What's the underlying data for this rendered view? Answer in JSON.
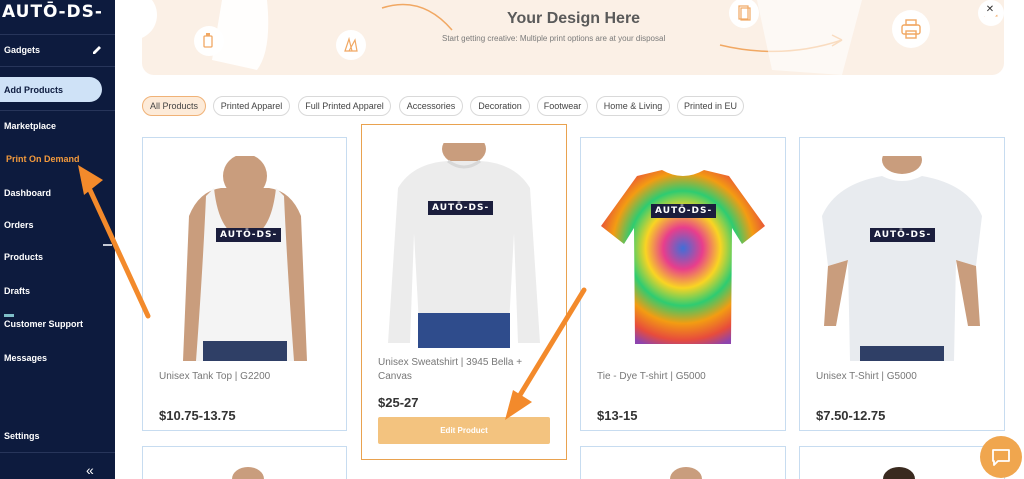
{
  "app": {
    "logo": "AUTŌ-DS-"
  },
  "sidebar": {
    "store": "Gadgets",
    "add_products": "Add Products",
    "items": [
      {
        "label": "Marketplace"
      },
      {
        "label": "Print On Demand"
      },
      {
        "label": "Dashboard"
      },
      {
        "label": "Orders"
      },
      {
        "label": "Products"
      },
      {
        "label": "Drafts"
      },
      {
        "label": "Customer Support"
      },
      {
        "label": "Messages"
      }
    ],
    "settings": "Settings",
    "collapse": "«"
  },
  "banner": {
    "title": "Your Design Here",
    "subtitle": "Start getting creative: Multiple print options are at your disposal"
  },
  "filters": [
    {
      "label": "All Products",
      "active": true
    },
    {
      "label": "Printed Apparel",
      "active": false
    },
    {
      "label": "Full Printed Apparel",
      "active": false
    },
    {
      "label": "Accessories",
      "active": false
    },
    {
      "label": "Decoration",
      "active": false
    },
    {
      "label": "Footwear",
      "active": false
    },
    {
      "label": "Home & Living",
      "active": false
    },
    {
      "label": "Printed in EU",
      "active": false
    }
  ],
  "products": [
    {
      "name": "Unisex Tank Top | G2200",
      "price": "$10.75-13.75",
      "image": "tank-top-model"
    },
    {
      "name": "Unisex Sweatshirt | 3945 Bella + Canvas",
      "price": "$25-27",
      "image": "sweatshirt-model",
      "action": "Edit Product"
    },
    {
      "name": "Tie - Dye T-shirt | G5000",
      "price": "$13-15",
      "image": "tie-dye-shirt"
    },
    {
      "name": "Unisex T-Shirt | G5000",
      "price": "$7.50-12.75",
      "image": "tshirt-model"
    }
  ],
  "colors": {
    "sidebar_bg": "#0d1b3e",
    "accent": "#f39a3c",
    "card_border": "#c7dcf0",
    "selected_border": "#e9a24f",
    "banner_bg": "#fbf0e6"
  }
}
